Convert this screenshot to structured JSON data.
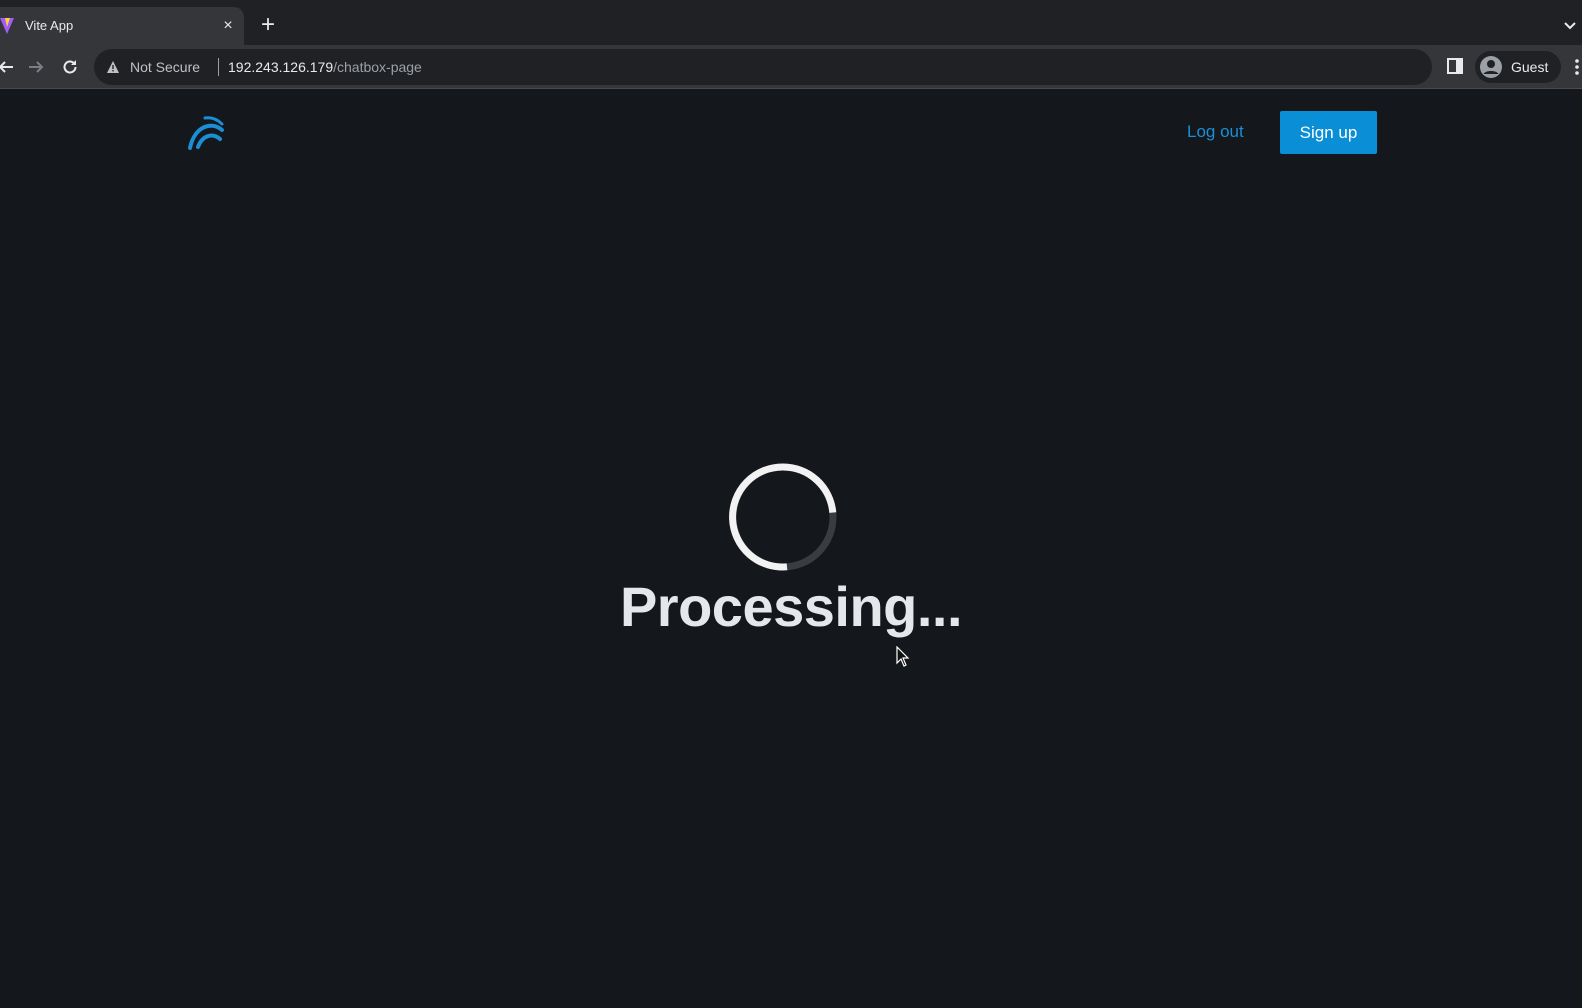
{
  "browser": {
    "tab_title": "Vite App",
    "close_glyph": "×",
    "new_tab_glyph": "+",
    "security_label": "Not Secure",
    "url_host": "192.243.126.179",
    "url_path": "/chatbox-page",
    "profile_label": "Guest"
  },
  "header": {
    "logo_icon": "wave-logo-icon",
    "logout_label": "Log out",
    "signup_label": "Sign up"
  },
  "main": {
    "status_text": "Processing..."
  },
  "colors": {
    "accent": "#0a8fd6",
    "background": "#14171b",
    "status_text": "#e5e7ea"
  }
}
